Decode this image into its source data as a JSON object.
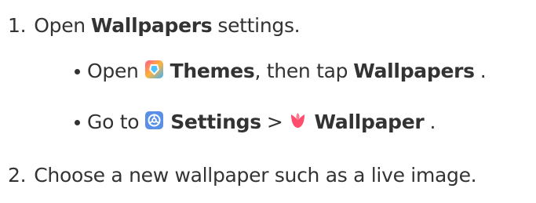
{
  "steps": [
    {
      "number": "1.",
      "pre": "Open",
      "bold": "Wallpapers",
      "post": "settings."
    },
    {
      "number": "2.",
      "text": "Choose a new wallpaper such as a live image."
    }
  ],
  "substeps": [
    {
      "pre": "Open",
      "icon": "themes-app-icon",
      "bold1": "Themes",
      "mid": ", then tap",
      "bold2": "Wallpapers",
      "post": "."
    },
    {
      "pre": "Go to",
      "icon": "settings-app-icon",
      "bold1": "Settings",
      "sep": ">",
      "icon2": "wallpaper-tulip-icon",
      "bold2": "Wallpaper",
      "post": "."
    }
  ],
  "colors": {
    "text": "#333333",
    "themes_icon": [
      "#ff5b8a",
      "#ffb43a",
      "#3ab0ff"
    ],
    "settings_icon": "#5a8fe6",
    "tulip_icon": "#ff4d6d"
  }
}
